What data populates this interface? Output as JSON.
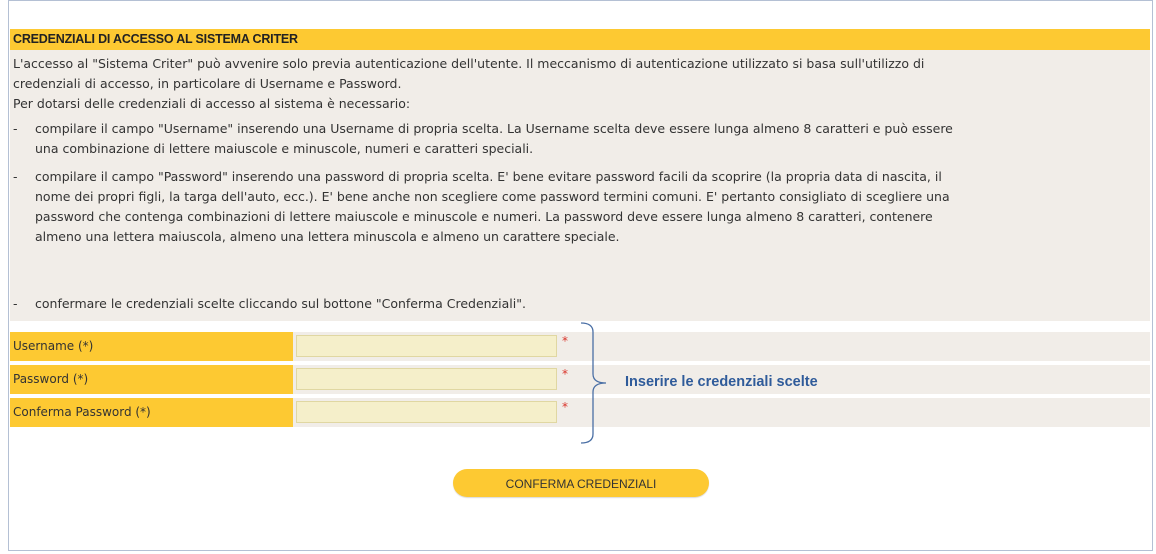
{
  "header": {
    "title": "CREDENZIALI DI ACCESSO AL SISTEMA CRITER"
  },
  "intro": {
    "line1": "L'accesso al \"Sistema Criter\" può avvenire solo previa autenticazione dell'utente. Il meccanismo di autenticazione utilizzato si basa sull'utilizzo di",
    "line2": "credenziali di accesso, in particolare di Username e Password.",
    "line3": "Per dotarsi delle credenziali di accesso al sistema è necessario:"
  },
  "bullets": [
    {
      "lines": [
        "compilare il campo \"Username\" inserendo una Username di propria scelta. La Username scelta deve essere lunga almeno 8 caratteri e può essere",
        "una combinazione di lettere maiuscole e minuscole, numeri e caratteri speciali."
      ]
    },
    {
      "lines": [
        "compilare il campo \"Password\" inserendo una password di propria scelta. E' bene evitare password facili da scoprire (la propria data di nascita, il",
        "nome dei propri figli, la targa dell'auto, ecc.). E' bene anche non scegliere come password termini comuni. E' pertanto consigliato di scegliere una",
        "password che contenga combinazioni di lettere maiuscole e minuscole e numeri. La password deve essere lunga almeno 8 caratteri, contenere",
        "almeno una lettera maiuscola, almeno una lettera minuscola e almeno un carattere speciale."
      ]
    },
    {
      "lines": [
        "confermare le credenziali scelte cliccando sul bottone \"Conferma Credenziali\"."
      ]
    }
  ],
  "bullet_marker": "-",
  "form": {
    "username_label": "Username (*)",
    "username_value": "",
    "password_label": "Password (*)",
    "password_value": "",
    "confirm_label": "Conferma Password (*)",
    "confirm_value": "",
    "required_mark": "*"
  },
  "annotation": "Inserire le credenziali scelte",
  "button": {
    "label": "CONFERMA CREDENZIALI"
  },
  "colors": {
    "accent": "#fdc932",
    "panel": "#f1ede8",
    "input_bg": "#f5efca",
    "required": "#d9342b",
    "annotation": "#2f5b9a"
  }
}
